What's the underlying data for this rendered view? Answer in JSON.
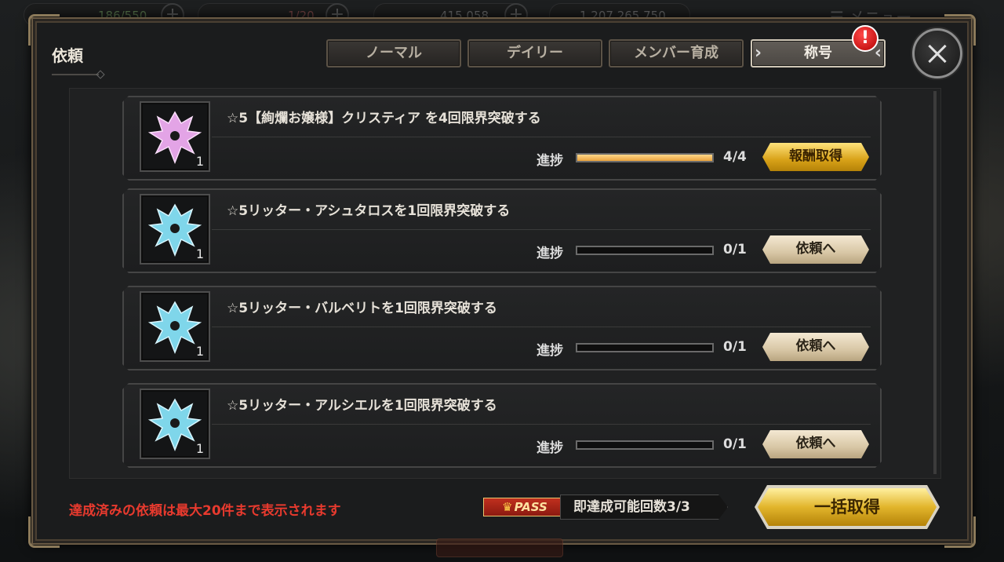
{
  "panel": {
    "title": "依頼"
  },
  "tabs": [
    {
      "label": "ノーマル",
      "active": false
    },
    {
      "label": "デイリー",
      "active": false
    },
    {
      "label": "メンバー育成",
      "active": false
    },
    {
      "label": "称号",
      "active": true
    }
  ],
  "alert_badge": "!",
  "quests": [
    {
      "title": "☆5【絢爛お嬢様】クリスティア を4回限界突破する",
      "reward_count": "1",
      "icon": "pink-crest-icon",
      "icon_color": "#e3a4e6",
      "progress_label": "進捗",
      "progress_text": "4/4",
      "progress_fraction": 1.0,
      "action_label": "報酬取得",
      "action_style": "gold"
    },
    {
      "title": "☆5リッター・アシュタロスを1回限界突破する",
      "reward_count": "1",
      "icon": "blue-crest-icon",
      "icon_color": "#7fd6ea",
      "progress_label": "進捗",
      "progress_text": "0/1",
      "progress_fraction": 0.0,
      "action_label": "依頼へ",
      "action_style": "beige"
    },
    {
      "title": "☆5リッター・バルベリトを1回限界突破する",
      "reward_count": "1",
      "icon": "blue-crest-icon",
      "icon_color": "#7fd6ea",
      "progress_label": "進捗",
      "progress_text": "0/1",
      "progress_fraction": 0.0,
      "action_label": "依頼へ",
      "action_style": "beige"
    },
    {
      "title": "☆5リッター・アルシエルを1回限界突破する",
      "reward_count": "1",
      "icon": "blue-crest-icon",
      "icon_color": "#7fd6ea",
      "progress_label": "進捗",
      "progress_text": "0/1",
      "progress_fraction": 0.0,
      "action_label": "依頼へ",
      "action_style": "beige"
    }
  ],
  "footer": {
    "notice": "達成済みの依頼は最大20件まで表示されます",
    "pass_label": "PASS",
    "instant_clear": "即達成可能回数3/3",
    "claim_all": "一括取得",
    "notice_color": "#e83a2e"
  },
  "hud": {
    "ap": "186/550",
    "bp": "1/20",
    "currency_1": "415,058",
    "currency_2": "1,207,265,750",
    "menu": "メニュー"
  }
}
